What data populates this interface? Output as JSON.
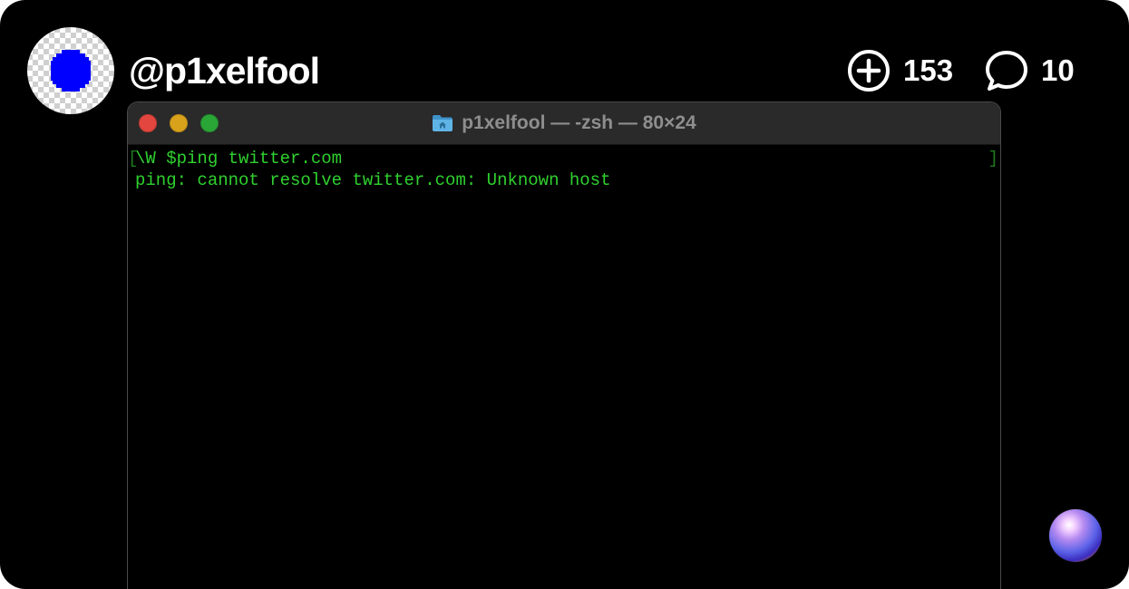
{
  "profile": {
    "username": "@p1xelfool",
    "avatar_icon": "blue-pixel-circle-icon"
  },
  "stats": {
    "remix_icon": "plus-circle-icon",
    "remix_count": "153",
    "comment_icon": "speech-bubble-icon",
    "comment_count": "10"
  },
  "terminal": {
    "folder_icon": "home-folder-icon",
    "title": "p1xelfool — -zsh — 80×24",
    "bracket_left": "[",
    "bracket_right": "]",
    "lines": [
      "\\W $ping twitter.com",
      "ping: cannot resolve twitter.com: Unknown host"
    ]
  },
  "colors": {
    "background": "#000000",
    "terminal_text": "#2fd12f",
    "avatar_dot": "#0000ff",
    "username": "#ffffff"
  }
}
